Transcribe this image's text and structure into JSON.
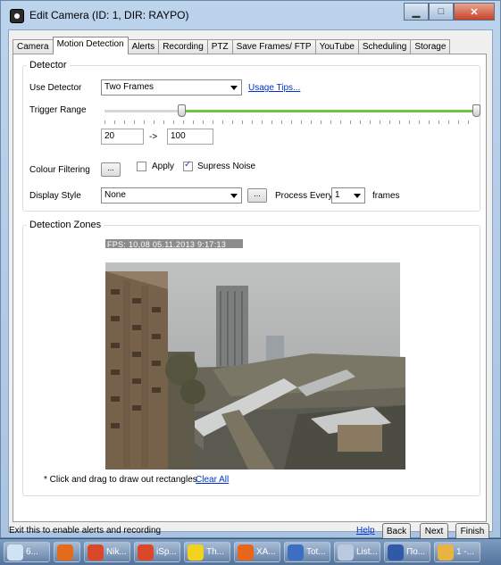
{
  "window": {
    "title": "Edit Camera (ID: 1, DIR: RAYPO)"
  },
  "tabs": [
    "Camera",
    "Motion Detection",
    "Alerts",
    "Recording",
    "PTZ",
    "Save Frames/ FTP",
    "YouTube",
    "Scheduling",
    "Storage"
  ],
  "active_tab": "Motion Detection",
  "detector": {
    "legend": "Detector",
    "use_detector_label": "Use Detector",
    "use_detector_value": "Two Frames",
    "usage_tips": "Usage Tips...",
    "trigger_range_label": "Trigger Range",
    "range_min": "20",
    "range_arrow": "->",
    "range_max": "100",
    "colour_filtering_label": "Colour Filtering",
    "ellipsis": "...",
    "apply_label": "Apply",
    "apply_checked": false,
    "supress_label": "Supress Noise",
    "supress_checked": true,
    "display_style_label": "Display Style",
    "display_style_value": "None",
    "process_every_label": "Process Every",
    "process_every_value": "1",
    "frames_label": "frames"
  },
  "zones": {
    "legend": "Detection Zones",
    "fps_overlay": "FPS: 10,08 05.11.2013 9:17:13",
    "hint": "* Click and drag to draw out rectangles",
    "clear_all": "Clear All"
  },
  "footer": {
    "status": "Exit this to enable alerts and recording",
    "help": "Help",
    "back": "Back",
    "next": "Next",
    "finish": "Finish"
  },
  "taskbar": [
    {
      "label": "6...",
      "icon": "partial-icon",
      "color": "#cfe3f5"
    },
    {
      "label": "",
      "icon": "media-player-icon",
      "color": "#e46b1b"
    },
    {
      "label": "Nik...",
      "icon": "chrome-icon",
      "color": "#d9482b"
    },
    {
      "label": "iSp...",
      "icon": "chrome-icon",
      "color": "#d9482b"
    },
    {
      "label": "Th...",
      "icon": "batman-icon",
      "color": "#f1d21f"
    },
    {
      "label": "XA...",
      "icon": "xampp-icon",
      "color": "#e8651d"
    },
    {
      "label": "Tot...",
      "icon": "floppy-icon",
      "color": "#3c6fc4"
    },
    {
      "label": "List...",
      "icon": "list-icon",
      "color": "#b8c9e0"
    },
    {
      "label": "По...",
      "icon": "word-icon",
      "color": "#2f5aa8"
    },
    {
      "label": "1 -...",
      "icon": "paint-icon",
      "color": "#e7b343"
    }
  ],
  "colors": {
    "slider_green": "#76c043",
    "link": "#0033cc"
  }
}
